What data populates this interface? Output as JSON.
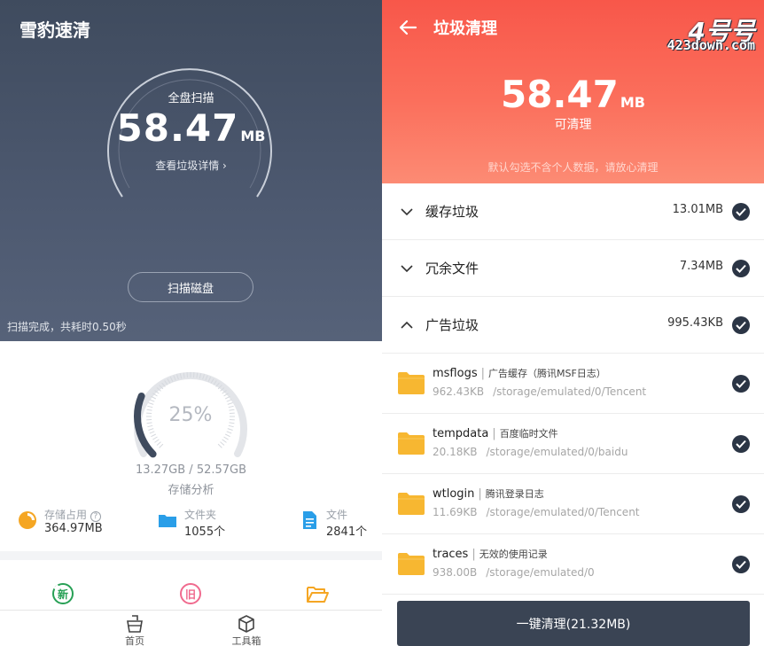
{
  "left": {
    "app_title": "雪豹速清",
    "scan": {
      "label": "全盘扫描",
      "size_value": "58.47",
      "size_unit": "MB",
      "detail_link": "查看垃圾详情 ›"
    },
    "scan_button": "扫描磁盘",
    "status": "扫描完成，共耗时0.50秒",
    "storage": {
      "percent_text": "25%",
      "percent": 25,
      "usage": "13.27GB / 52.57GB",
      "caption": "存储分析"
    },
    "stats": [
      {
        "label": "存储占用",
        "value": "364.97MB",
        "icon": "pie-chart-icon",
        "color": "#f5a623"
      },
      {
        "label": "文件夹",
        "value": "1055个",
        "icon": "folder-icon",
        "color": "#2a9ee8"
      },
      {
        "label": "文件",
        "value": "2841个",
        "icon": "document-icon",
        "color": "#2a9ee8"
      }
    ],
    "tools": [
      {
        "icon": "new-badge-icon",
        "glyph": "新",
        "color": "#27a055"
      },
      {
        "icon": "old-badge-icon",
        "glyph": "旧",
        "color": "#f06a8e"
      },
      {
        "icon": "open-folder-icon",
        "color": "#f5a623"
      }
    ],
    "nav": [
      {
        "label": "首页",
        "icon": "broom-basket-icon"
      },
      {
        "label": "工具箱",
        "icon": "cube-icon"
      }
    ]
  },
  "right": {
    "title": "垃圾清理",
    "watermark_brand": "4号号",
    "watermark_url": "423down.com",
    "size_value": "58.47",
    "size_unit": "MB",
    "size_caption": "可清理",
    "note": "默认勾选不含个人数据，请放心清理",
    "categories": [
      {
        "name": "缓存垃圾",
        "size": "13.01MB",
        "expanded": false
      },
      {
        "name": "冗余文件",
        "size": "7.34MB",
        "expanded": false
      },
      {
        "name": "广告垃圾",
        "size": "995.43KB",
        "expanded": true
      }
    ],
    "items": [
      {
        "name": "msflogs",
        "desc": "广告缓存（腾讯MSF日志）",
        "size": "962.43KB",
        "path": "/storage/emulated/0/Tencent"
      },
      {
        "name": "tempdata",
        "desc": "百度临时文件",
        "size": "20.18KB",
        "path": "/storage/emulated/0/baidu"
      },
      {
        "name": "wtlogin",
        "desc": "腾讯登录日志",
        "size": "11.69KB",
        "path": "/storage/emulated/0/Tencent"
      },
      {
        "name": "traces",
        "desc": "无效的使用记录",
        "size": "938.00B",
        "path": "/storage/emulated/0"
      }
    ],
    "clean_button": "一键清理(21.32MB)"
  }
}
